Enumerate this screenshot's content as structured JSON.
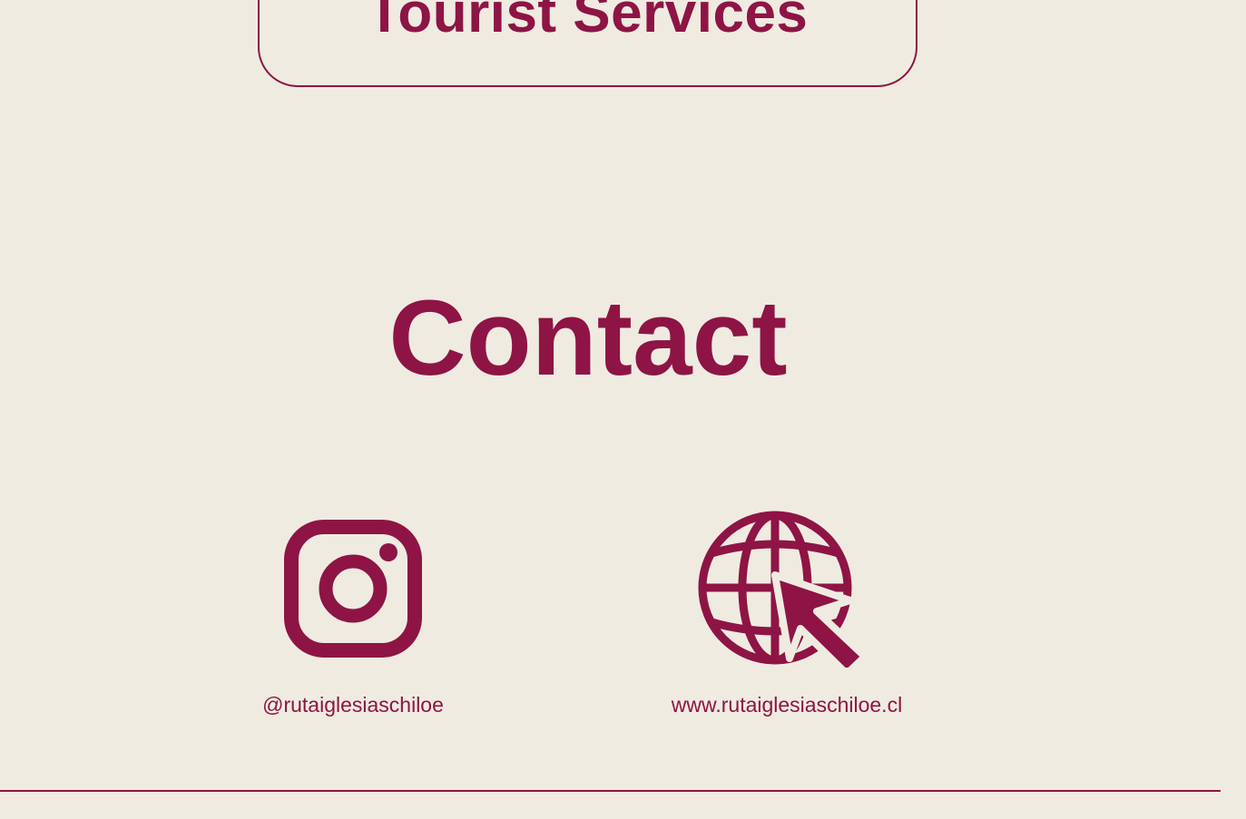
{
  "services": {
    "title": "Tourist Services"
  },
  "contact": {
    "title": "Contact",
    "items": [
      {
        "icon": "instagram-icon",
        "label": "@rutaiglesiaschiloe"
      },
      {
        "icon": "globe-cursor-icon",
        "label": "www.rutaiglesiaschiloe.cl"
      }
    ]
  },
  "colors": {
    "background": "#efebe1",
    "accent": "#8e1445"
  }
}
